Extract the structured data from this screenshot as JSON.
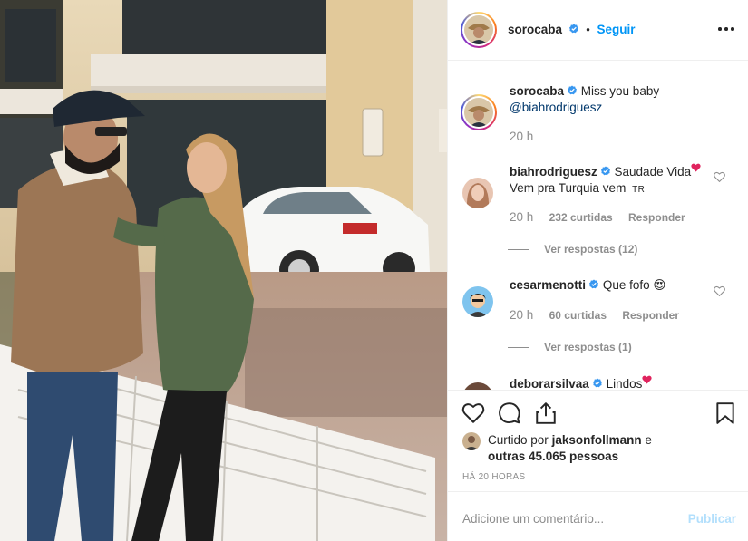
{
  "header": {
    "username": "sorocaba",
    "dot": "•",
    "follow_label": "Seguir"
  },
  "caption": {
    "username": "sorocaba",
    "text": "Miss you baby",
    "mention": "@biahrodriguesz",
    "time": "20 h"
  },
  "comments": [
    {
      "username": "biahrodriguesz",
      "text": "Saudade Vida",
      "text2": "Vem pra Turquia vem",
      "flag": "TR",
      "time": "20 h",
      "likes": "232 curtidas",
      "reply": "Responder",
      "view_replies": "Ver respostas (12)"
    },
    {
      "username": "cesarmenotti",
      "text": "Que fofo",
      "emoji": "😍",
      "time": "20 h",
      "likes": "60 curtidas",
      "reply": "Responder",
      "view_replies": "Ver respostas (1)"
    },
    {
      "username": "deborarsilvaa",
      "text": "Lindos"
    }
  ],
  "likes": {
    "prefix": "Curtido por",
    "user": "jaksonfollmann",
    "and": "e",
    "others": "outras 45.065 pessoas"
  },
  "time_ago": "HÁ 20 HORAS",
  "add_comment": {
    "placeholder": "Adicione um comentário...",
    "post_label": "Publicar"
  },
  "colors": {
    "link_blue": "#0095f6",
    "verified_blue": "#3897f0",
    "muted": "#8e8e8e",
    "heart_red": "#ed4956",
    "post_disabled": "#b2dffc"
  },
  "icons": {
    "verified": "verified-badge-icon",
    "more": "more-options-icon",
    "heart": "heart-icon",
    "comment": "comment-icon",
    "share": "share-icon",
    "save": "bookmark-icon"
  }
}
